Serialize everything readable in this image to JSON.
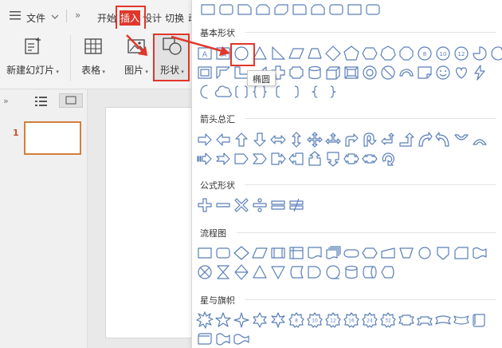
{
  "menu": {
    "hamburger_icon": "menu-icon",
    "file": "文件",
    "more": "»",
    "tabs": [
      "开始",
      "插入",
      "设计",
      "切换",
      "动"
    ]
  },
  "ribbon": {
    "new_slide": "新建幻灯片",
    "table": "表格",
    "picture": "图片",
    "shapes": "形状"
  },
  "thumbnails": {
    "slide_number": "1"
  },
  "tooltip": "椭圆",
  "sections": [
    {
      "title": "基本形状"
    },
    {
      "title": "箭头总汇"
    },
    {
      "title": "公式形状"
    },
    {
      "title": "流程图"
    },
    {
      "title": "星与旗帜"
    }
  ],
  "badge_numbers": [
    "8",
    "10",
    "12",
    "8",
    "10",
    "12",
    "16",
    "24",
    "32"
  ],
  "colors": {
    "highlight": "#e1372b",
    "shape_stroke": "#5a7fb8",
    "thumb_border": "#d0803c"
  }
}
